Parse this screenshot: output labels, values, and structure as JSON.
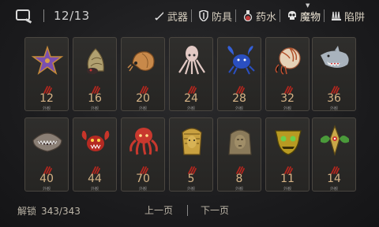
{
  "header": {
    "page_counter": "12/13",
    "categories": [
      {
        "label": "武器",
        "icon": "sword-icon"
      },
      {
        "label": "防具",
        "icon": "shield-icon"
      },
      {
        "label": "药水",
        "icon": "potion-icon"
      },
      {
        "label": "魔物",
        "icon": "skull-icon",
        "active": true
      },
      {
        "label": "陷阱",
        "icon": "trap-icon"
      }
    ]
  },
  "cards": [
    {
      "creature": "starfish",
      "value": "12",
      "small": "外観"
    },
    {
      "creature": "hermit-crab",
      "value": "16",
      "small": "外観"
    },
    {
      "creature": "shrimp-shell",
      "value": "20",
      "small": "外観"
    },
    {
      "creature": "squid",
      "value": "24",
      "small": "外観"
    },
    {
      "creature": "blue-lobster",
      "value": "28",
      "small": "外観"
    },
    {
      "creature": "nautilus",
      "value": "32",
      "small": "外観"
    },
    {
      "creature": "shark",
      "value": "36",
      "small": "外観"
    },
    {
      "creature": "giant-clam",
      "value": "40",
      "small": "外観"
    },
    {
      "creature": "red-crab",
      "value": "44",
      "small": "外観"
    },
    {
      "creature": "octopus",
      "value": "70",
      "small": "外観"
    },
    {
      "creature": "golden-pharaoh",
      "value": "5",
      "small": "外観"
    },
    {
      "creature": "sphinx-head",
      "value": "8",
      "small": "外観"
    },
    {
      "creature": "golden-mask",
      "value": "11",
      "small": "外観"
    },
    {
      "creature": "green-idol",
      "value": "14",
      "small": "外観"
    }
  ],
  "footer": {
    "unlock_label": "解锁",
    "unlock_value": "343/343",
    "prev_label": "上一页",
    "next_label": "下一页"
  }
}
